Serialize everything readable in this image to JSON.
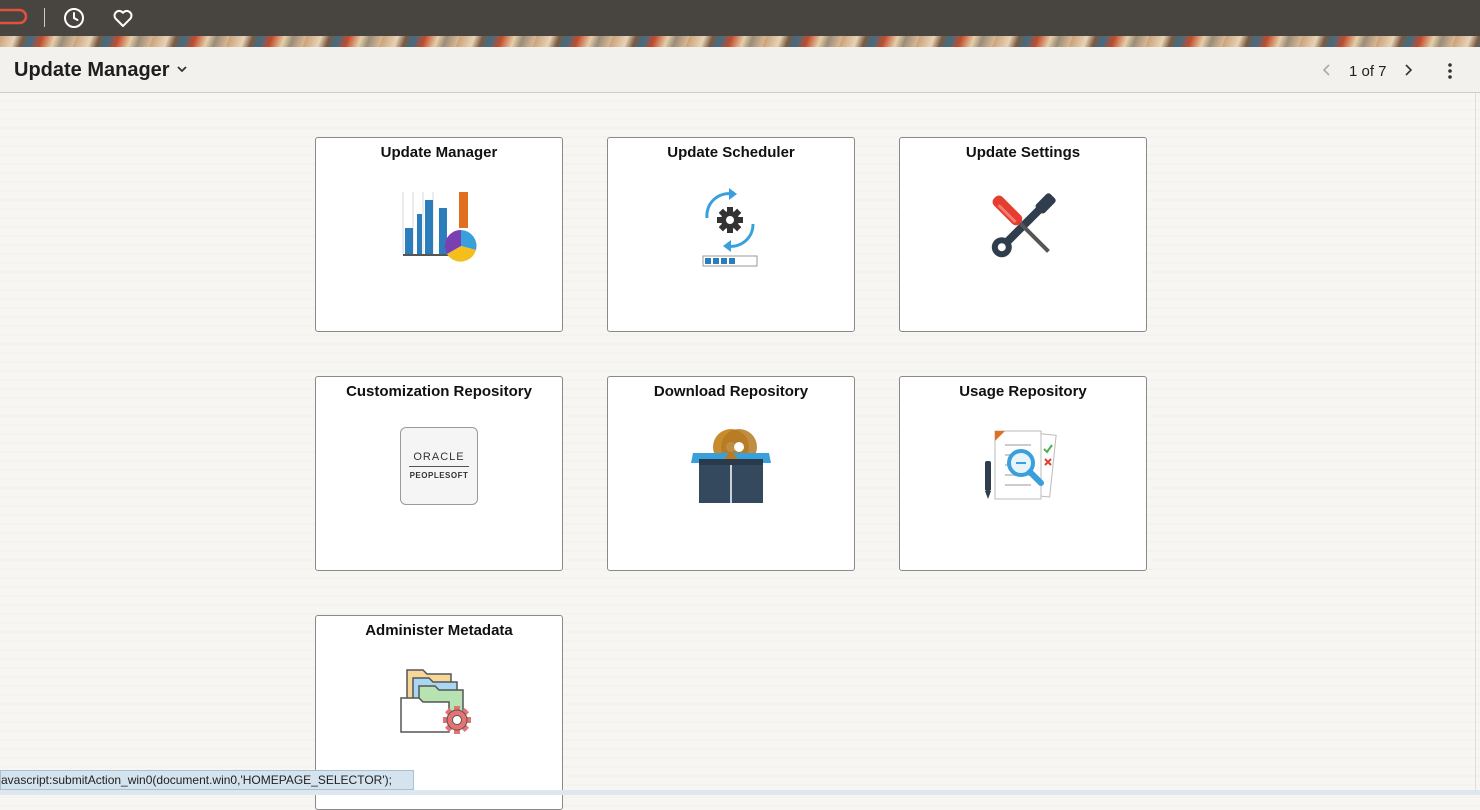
{
  "header": {
    "icons": [
      "oracle-logo",
      "recent-icon",
      "favorites-icon"
    ]
  },
  "titlebar": {
    "title": "Update Manager",
    "pager": "1 of 7"
  },
  "tiles": [
    {
      "title": "Update Manager",
      "icon": "chart-icon"
    },
    {
      "title": "Update Scheduler",
      "icon": "scheduler-gear-icon"
    },
    {
      "title": "Update Settings",
      "icon": "wrench-screwdriver-icon"
    },
    {
      "title": "Customization Repository",
      "icon": "oracle-peoplesoft-logo"
    },
    {
      "title": "Download Repository",
      "icon": "box-discs-icon"
    },
    {
      "title": "Usage Repository",
      "icon": "documents-magnifier-icon"
    },
    {
      "title": "Administer Metadata",
      "icon": "folders-gear-icon"
    }
  ],
  "logo_text": {
    "oracle": "ORACLE",
    "peoplesoft": "PEOPLESOFT"
  },
  "status": {
    "text": "avascript:submitAction_win0(document.win0,'HOMEPAGE_SELECTOR');"
  },
  "colors": {
    "topbar": "#48443f",
    "oracle_red": "#c74634",
    "accent_blue": "#2b7dbc",
    "accent_orange": "#e07020"
  }
}
